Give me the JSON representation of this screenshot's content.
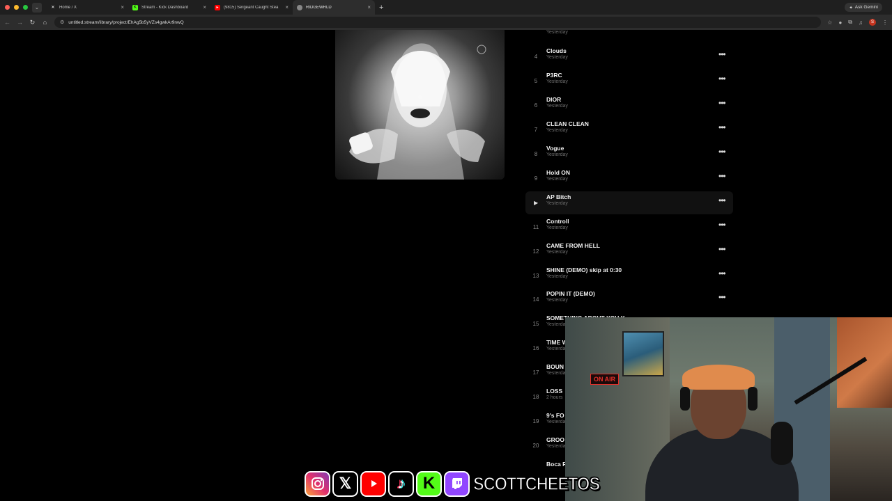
{
  "browser": {
    "tabs": [
      {
        "title": "Home / X",
        "icon": "x-logo-icon",
        "active": false
      },
      {
        "title": "Stream - Kick Dashboard",
        "icon": "kick-logo-icon",
        "active": false
      },
      {
        "title": "(9815) Sergeant Caught Stea",
        "icon": "youtube-logo-icon",
        "active": false
      },
      {
        "title": "RIDGEWRLD",
        "icon": "globe-icon",
        "active": true
      }
    ],
    "ask_gemini": "Ask Gemini",
    "url": "untitled.stream/library/project/EhAg5b5yVZs4gwkAr9nwQ",
    "profile_initial": "S"
  },
  "tracklist": {
    "partial_top_subtitle": "Yesterday",
    "tracks": [
      {
        "num": "4",
        "title": "Clouds",
        "sub": "Yesterday"
      },
      {
        "num": "5",
        "title": "P3RC",
        "sub": "Yesterday"
      },
      {
        "num": "6",
        "title": "DIOR",
        "sub": "Yesterday"
      },
      {
        "num": "7",
        "title": "CLEAN CLEAN",
        "sub": "Yesterday"
      },
      {
        "num": "8",
        "title": "Vogue",
        "sub": "Yesterday"
      },
      {
        "num": "9",
        "title": "Hold ON",
        "sub": "Yesterday"
      },
      {
        "num": "10",
        "title": "AP Bitch",
        "sub": "Yesterday",
        "hover": true
      },
      {
        "num": "11",
        "title": "Controll",
        "sub": "Yesterday"
      },
      {
        "num": "12",
        "title": "CAME FROM HELL",
        "sub": "Yesterday"
      },
      {
        "num": "13",
        "title": "SHINE (DEMO) skip at 0:30",
        "sub": "Yesterday"
      },
      {
        "num": "14",
        "title": "POPIN IT (DEMO)",
        "sub": "Yesterday"
      },
      {
        "num": "15",
        "title": "SOMETHING ABOUT YOU K",
        "sub": "Yesterday"
      },
      {
        "num": "16",
        "title": "TIME W",
        "sub": "Yesterday"
      },
      {
        "num": "17",
        "title": "BOUN",
        "sub": "Yesterday"
      },
      {
        "num": "18",
        "title": "LOSS",
        "sub": "2 hours"
      },
      {
        "num": "19",
        "title": "9's FO",
        "sub": "Yesterday"
      },
      {
        "num": "20",
        "title": "GROO",
        "sub": "Yesterday"
      },
      {
        "num": "",
        "title": "Boca R",
        "sub": ""
      }
    ]
  },
  "webcam": {
    "on_air": "ON AIR"
  },
  "social_banner": {
    "icons": [
      "instagram-icon",
      "x-icon",
      "youtube-icon",
      "tiktok-icon",
      "kick-icon",
      "twitch-icon"
    ],
    "handle": "SCOTTCHEETOS"
  }
}
